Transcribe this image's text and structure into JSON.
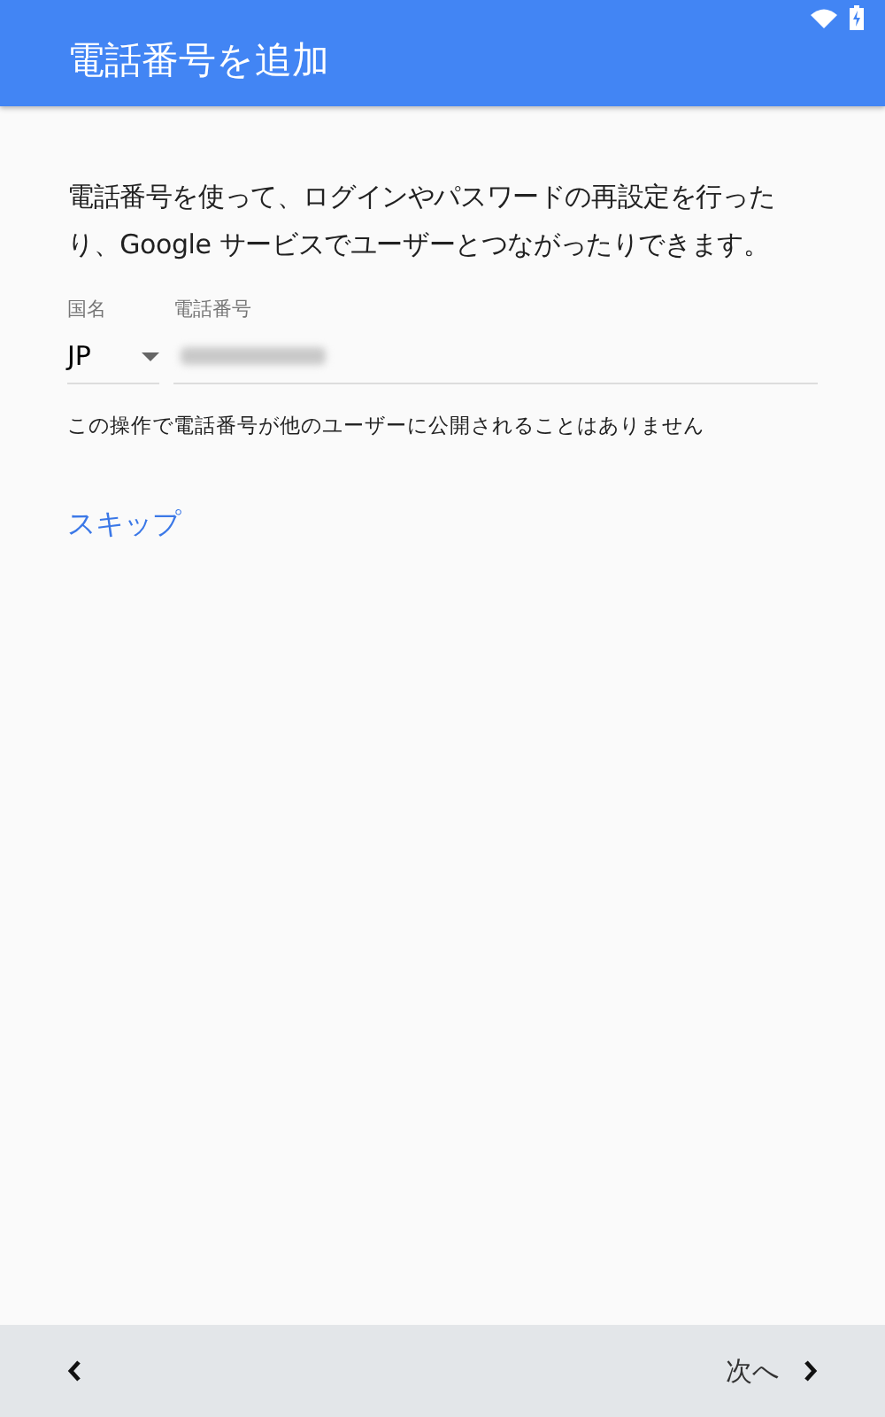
{
  "app_bar": {
    "title": "電話番号を追加"
  },
  "description": "電話番号を使って、ログインやパスワードの再設定を行ったり、Google サービスでユーザーとつながったりできます。",
  "country_field": {
    "label": "国名",
    "value": "JP"
  },
  "phone_field": {
    "label": "電話番号",
    "value_redacted": true
  },
  "note": "この操作で電話番号が他のユーザーに公開されることはありません",
  "skip_link": "スキップ",
  "bottom_bar": {
    "next": "次へ"
  }
}
